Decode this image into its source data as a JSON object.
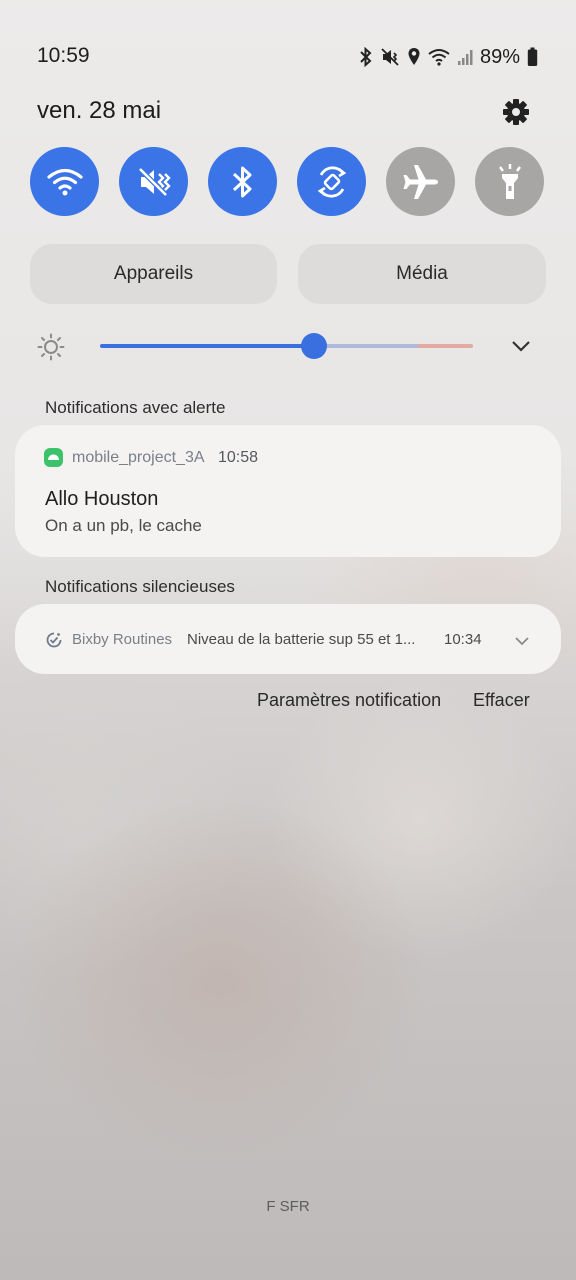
{
  "status_bar": {
    "time": "10:59",
    "battery": "89%",
    "icons": [
      "bluetooth-icon",
      "vibrate-mute-icon",
      "location-icon",
      "wifi-icon",
      "signal-icon",
      "battery-icon"
    ]
  },
  "header": {
    "date": "ven. 28 mai",
    "settings_icon": "gear-icon"
  },
  "quick_toggles": [
    {
      "name": "wifi",
      "icon": "wifi-icon",
      "state": "on"
    },
    {
      "name": "sound",
      "icon": "vibrate-mute-icon",
      "state": "on"
    },
    {
      "name": "bluetooth",
      "icon": "bluetooth-icon",
      "state": "on"
    },
    {
      "name": "auto-rotate",
      "icon": "rotate-icon",
      "state": "on"
    },
    {
      "name": "airplane",
      "icon": "airplane-icon",
      "state": "off"
    },
    {
      "name": "flashlight",
      "icon": "flashlight-icon",
      "state": "off"
    }
  ],
  "pills": {
    "devices": "Appareils",
    "media": "Média"
  },
  "brightness": {
    "level": 0.57
  },
  "sections": {
    "alert": "Notifications avec alerte",
    "silent": "Notifications silencieuses"
  },
  "notifications": {
    "alert": {
      "app": "mobile_project_3A",
      "time": "10:58",
      "title": "Allo Houston",
      "body": "On a un pb, le cache",
      "app_color": "#3cc36a"
    },
    "silent": {
      "app": "Bixby Routines",
      "text": "Niveau de la batterie sup 55 et 1...",
      "time": "10:34"
    }
  },
  "actions": {
    "settings": "Paramètres notification",
    "clear": "Effacer"
  },
  "carrier": "F SFR",
  "colors": {
    "accent": "#3a74e6",
    "toggle_off": "#a8a6a5"
  }
}
